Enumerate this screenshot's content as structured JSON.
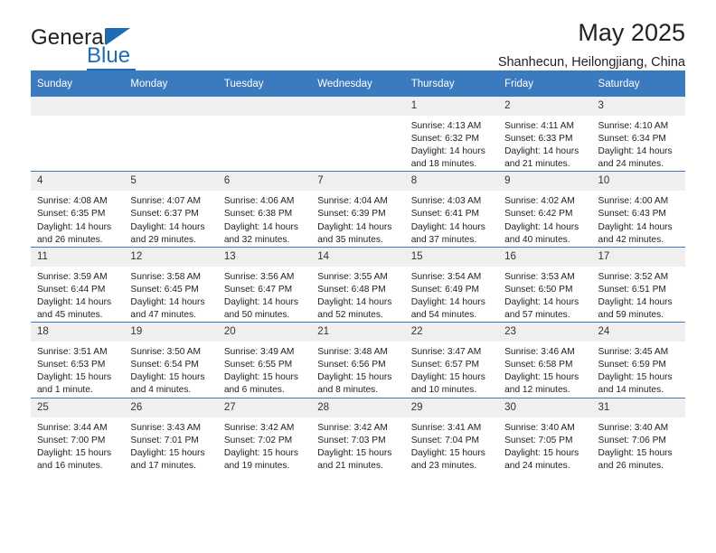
{
  "brand": {
    "name_part1": "General",
    "name_part2": "Blue",
    "accent_color": "#1d6cb5"
  },
  "header": {
    "title": "May 2025",
    "subtitle": "Shanhecun, Heilongjiang, China"
  },
  "calendar": {
    "header_bg": "#3a7bbf",
    "daynum_bg": "#efefef",
    "weekday_labels": [
      "Sunday",
      "Monday",
      "Tuesday",
      "Wednesday",
      "Thursday",
      "Friday",
      "Saturday"
    ],
    "weeks": [
      [
        {
          "day": "",
          "blank": true
        },
        {
          "day": "",
          "blank": true
        },
        {
          "day": "",
          "blank": true
        },
        {
          "day": "",
          "blank": true
        },
        {
          "day": "1",
          "sunrise": "Sunrise: 4:13 AM",
          "sunset": "Sunset: 6:32 PM",
          "daylight_l1": "Daylight: 14 hours",
          "daylight_l2": "and 18 minutes."
        },
        {
          "day": "2",
          "sunrise": "Sunrise: 4:11 AM",
          "sunset": "Sunset: 6:33 PM",
          "daylight_l1": "Daylight: 14 hours",
          "daylight_l2": "and 21 minutes."
        },
        {
          "day": "3",
          "sunrise": "Sunrise: 4:10 AM",
          "sunset": "Sunset: 6:34 PM",
          "daylight_l1": "Daylight: 14 hours",
          "daylight_l2": "and 24 minutes."
        }
      ],
      [
        {
          "day": "4",
          "sunrise": "Sunrise: 4:08 AM",
          "sunset": "Sunset: 6:35 PM",
          "daylight_l1": "Daylight: 14 hours",
          "daylight_l2": "and 26 minutes."
        },
        {
          "day": "5",
          "sunrise": "Sunrise: 4:07 AM",
          "sunset": "Sunset: 6:37 PM",
          "daylight_l1": "Daylight: 14 hours",
          "daylight_l2": "and 29 minutes."
        },
        {
          "day": "6",
          "sunrise": "Sunrise: 4:06 AM",
          "sunset": "Sunset: 6:38 PM",
          "daylight_l1": "Daylight: 14 hours",
          "daylight_l2": "and 32 minutes."
        },
        {
          "day": "7",
          "sunrise": "Sunrise: 4:04 AM",
          "sunset": "Sunset: 6:39 PM",
          "daylight_l1": "Daylight: 14 hours",
          "daylight_l2": "and 35 minutes."
        },
        {
          "day": "8",
          "sunrise": "Sunrise: 4:03 AM",
          "sunset": "Sunset: 6:41 PM",
          "daylight_l1": "Daylight: 14 hours",
          "daylight_l2": "and 37 minutes."
        },
        {
          "day": "9",
          "sunrise": "Sunrise: 4:02 AM",
          "sunset": "Sunset: 6:42 PM",
          "daylight_l1": "Daylight: 14 hours",
          "daylight_l2": "and 40 minutes."
        },
        {
          "day": "10",
          "sunrise": "Sunrise: 4:00 AM",
          "sunset": "Sunset: 6:43 PM",
          "daylight_l1": "Daylight: 14 hours",
          "daylight_l2": "and 42 minutes."
        }
      ],
      [
        {
          "day": "11",
          "sunrise": "Sunrise: 3:59 AM",
          "sunset": "Sunset: 6:44 PM",
          "daylight_l1": "Daylight: 14 hours",
          "daylight_l2": "and 45 minutes."
        },
        {
          "day": "12",
          "sunrise": "Sunrise: 3:58 AM",
          "sunset": "Sunset: 6:45 PM",
          "daylight_l1": "Daylight: 14 hours",
          "daylight_l2": "and 47 minutes."
        },
        {
          "day": "13",
          "sunrise": "Sunrise: 3:56 AM",
          "sunset": "Sunset: 6:47 PM",
          "daylight_l1": "Daylight: 14 hours",
          "daylight_l2": "and 50 minutes."
        },
        {
          "day": "14",
          "sunrise": "Sunrise: 3:55 AM",
          "sunset": "Sunset: 6:48 PM",
          "daylight_l1": "Daylight: 14 hours",
          "daylight_l2": "and 52 minutes."
        },
        {
          "day": "15",
          "sunrise": "Sunrise: 3:54 AM",
          "sunset": "Sunset: 6:49 PM",
          "daylight_l1": "Daylight: 14 hours",
          "daylight_l2": "and 54 minutes."
        },
        {
          "day": "16",
          "sunrise": "Sunrise: 3:53 AM",
          "sunset": "Sunset: 6:50 PM",
          "daylight_l1": "Daylight: 14 hours",
          "daylight_l2": "and 57 minutes."
        },
        {
          "day": "17",
          "sunrise": "Sunrise: 3:52 AM",
          "sunset": "Sunset: 6:51 PM",
          "daylight_l1": "Daylight: 14 hours",
          "daylight_l2": "and 59 minutes."
        }
      ],
      [
        {
          "day": "18",
          "sunrise": "Sunrise: 3:51 AM",
          "sunset": "Sunset: 6:53 PM",
          "daylight_l1": "Daylight: 15 hours",
          "daylight_l2": "and 1 minute."
        },
        {
          "day": "19",
          "sunrise": "Sunrise: 3:50 AM",
          "sunset": "Sunset: 6:54 PM",
          "daylight_l1": "Daylight: 15 hours",
          "daylight_l2": "and 4 minutes."
        },
        {
          "day": "20",
          "sunrise": "Sunrise: 3:49 AM",
          "sunset": "Sunset: 6:55 PM",
          "daylight_l1": "Daylight: 15 hours",
          "daylight_l2": "and 6 minutes."
        },
        {
          "day": "21",
          "sunrise": "Sunrise: 3:48 AM",
          "sunset": "Sunset: 6:56 PM",
          "daylight_l1": "Daylight: 15 hours",
          "daylight_l2": "and 8 minutes."
        },
        {
          "day": "22",
          "sunrise": "Sunrise: 3:47 AM",
          "sunset": "Sunset: 6:57 PM",
          "daylight_l1": "Daylight: 15 hours",
          "daylight_l2": "and 10 minutes."
        },
        {
          "day": "23",
          "sunrise": "Sunrise: 3:46 AM",
          "sunset": "Sunset: 6:58 PM",
          "daylight_l1": "Daylight: 15 hours",
          "daylight_l2": "and 12 minutes."
        },
        {
          "day": "24",
          "sunrise": "Sunrise: 3:45 AM",
          "sunset": "Sunset: 6:59 PM",
          "daylight_l1": "Daylight: 15 hours",
          "daylight_l2": "and 14 minutes."
        }
      ],
      [
        {
          "day": "25",
          "sunrise": "Sunrise: 3:44 AM",
          "sunset": "Sunset: 7:00 PM",
          "daylight_l1": "Daylight: 15 hours",
          "daylight_l2": "and 16 minutes."
        },
        {
          "day": "26",
          "sunrise": "Sunrise: 3:43 AM",
          "sunset": "Sunset: 7:01 PM",
          "daylight_l1": "Daylight: 15 hours",
          "daylight_l2": "and 17 minutes."
        },
        {
          "day": "27",
          "sunrise": "Sunrise: 3:42 AM",
          "sunset": "Sunset: 7:02 PM",
          "daylight_l1": "Daylight: 15 hours",
          "daylight_l2": "and 19 minutes."
        },
        {
          "day": "28",
          "sunrise": "Sunrise: 3:42 AM",
          "sunset": "Sunset: 7:03 PM",
          "daylight_l1": "Daylight: 15 hours",
          "daylight_l2": "and 21 minutes."
        },
        {
          "day": "29",
          "sunrise": "Sunrise: 3:41 AM",
          "sunset": "Sunset: 7:04 PM",
          "daylight_l1": "Daylight: 15 hours",
          "daylight_l2": "and 23 minutes."
        },
        {
          "day": "30",
          "sunrise": "Sunrise: 3:40 AM",
          "sunset": "Sunset: 7:05 PM",
          "daylight_l1": "Daylight: 15 hours",
          "daylight_l2": "and 24 minutes."
        },
        {
          "day": "31",
          "sunrise": "Sunrise: 3:40 AM",
          "sunset": "Sunset: 7:06 PM",
          "daylight_l1": "Daylight: 15 hours",
          "daylight_l2": "and 26 minutes."
        }
      ]
    ]
  }
}
